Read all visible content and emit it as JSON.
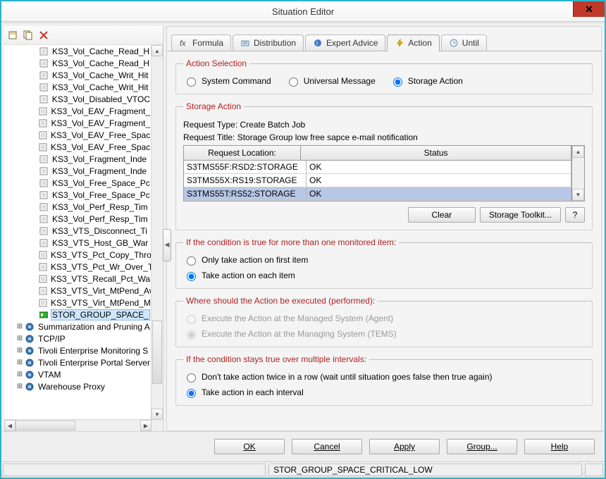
{
  "window": {
    "title": "Situation Editor"
  },
  "toolbar_icons": [
    "new-situation-icon",
    "copy-situation-icon",
    "delete-situation-icon"
  ],
  "tree": {
    "leaf_items": [
      "KS3_Vol_Cache_Read_H",
      "KS3_Vol_Cache_Read_H",
      "KS3_Vol_Cache_Writ_Hit",
      "KS3_Vol_Cache_Writ_Hit",
      "KS3_Vol_Disabled_VTOC",
      "KS3_Vol_EAV_Fragment_",
      "KS3_Vol_EAV_Fragment_",
      "KS3_Vol_EAV_Free_Spac",
      "KS3_Vol_EAV_Free_Spac",
      "KS3_Vol_Fragment_Inde",
      "KS3_Vol_Fragment_Inde",
      "KS3_Vol_Free_Space_Pc",
      "KS3_Vol_Free_Space_Pc",
      "KS3_Vol_Perf_Resp_Tim",
      "KS3_Vol_Perf_Resp_Tim",
      "KS3_VTS_Disconnect_Ti",
      "KS3_VTS_Host_GB_War",
      "KS3_VTS_Pct_Copy_Thro",
      "KS3_VTS_Pct_Wr_Over_T",
      "KS3_VTS_Recall_Pct_Wa",
      "KS3_VTS_Virt_MtPend_Av",
      "KS3_VTS_Virt_MtPend_M",
      "STOR_GROUP_SPACE_"
    ],
    "selected_index": 22,
    "top_items": [
      "Summarization and Pruning A",
      "TCP/IP",
      "Tivoli Enterprise Monitoring S",
      "Tivoli Enterprise Portal Server",
      "VTAM",
      "Warehouse Proxy"
    ]
  },
  "tabs": [
    {
      "id": "formula",
      "label": "Formula"
    },
    {
      "id": "distribution",
      "label": "Distribution"
    },
    {
      "id": "expert",
      "label": "Expert Advice"
    },
    {
      "id": "action",
      "label": "Action"
    },
    {
      "id": "until",
      "label": "Until"
    }
  ],
  "active_tab": "action",
  "action_selection": {
    "legend": "Action Selection",
    "options": [
      "System Command",
      "Universal Message",
      "Storage Action"
    ],
    "selected": "Storage Action"
  },
  "storage_action": {
    "legend": "Storage Action",
    "request_type_label": "Request Type:",
    "request_type_value": "Create Batch Job",
    "request_title_label": "Request Title:",
    "request_title_value": "Storage Group low free sapce e-mail notification",
    "columns": [
      "Request Location:",
      "Status"
    ],
    "rows": [
      {
        "loc": "S3TMS55F:RSD2:STORAGE",
        "status": "OK"
      },
      {
        "loc": "S3TMS55X:RS19:STORAGE",
        "status": "OK"
      },
      {
        "loc": "S3TMS55T:RS52:STORAGE",
        "status": "OK"
      }
    ],
    "selected_row": 2,
    "buttons": {
      "clear": "Clear",
      "toolkit": "Storage Toolkit...",
      "help": "?"
    }
  },
  "multi_item": {
    "legend": "If the condition is true for more than one monitored item:",
    "options": [
      "Only take action on first item",
      "Take action on each item"
    ],
    "selected": 1
  },
  "where_exec": {
    "legend": "Where should the Action be executed (performed):",
    "options": [
      "Execute the Action at the Managed System (Agent)",
      "Execute the Action at the Managing System (TEMS)"
    ],
    "selected": 1,
    "disabled": true
  },
  "intervals": {
    "legend": "If the condition stays true over multiple intervals:",
    "options": [
      "Don't take action twice in a row (wait until situation goes false then true again)",
      "Take action in each interval"
    ],
    "selected": 1
  },
  "dialog_buttons": {
    "ok": "OK",
    "cancel": "Cancel",
    "apply": "Apply",
    "group": "Group...",
    "help": "Help"
  },
  "status_bar": {
    "situation_id": "STOR_GROUP_SPACE_CRITICAL_LOW"
  }
}
